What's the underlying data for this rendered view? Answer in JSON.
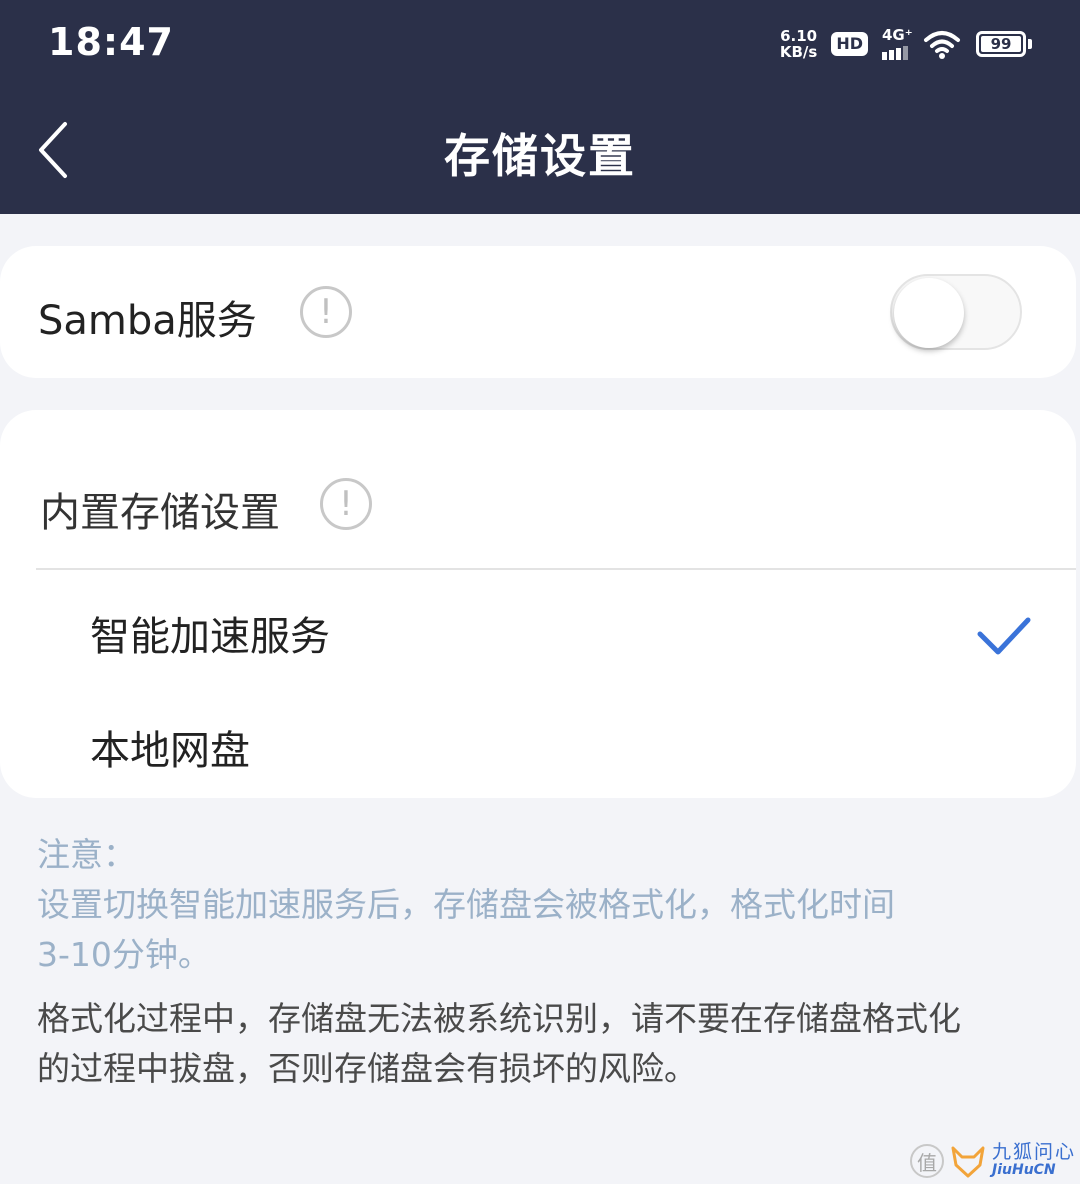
{
  "status_bar": {
    "time": "18:47",
    "net_speed_value": "6.10",
    "net_speed_unit": "KB/s",
    "hd_label": "HD",
    "network_label": "4G⁺",
    "battery_level": "99"
  },
  "header": {
    "title": "存储设置"
  },
  "samba": {
    "label": "Samba服务",
    "info_glyph": "!",
    "enabled": false
  },
  "storage": {
    "section_title": "内置存储设置",
    "info_glyph": "!",
    "options": [
      {
        "label": "智能加速服务",
        "selected": true
      },
      {
        "label": "本地网盘",
        "selected": false
      }
    ]
  },
  "notes": {
    "heading": "注意：",
    "line1": "设置切换智能加速服务后，存储盘会被格式化，格式化时间",
    "line2": "3-10分钟。",
    "line3": "格式化过程中，存储盘无法被系统识别，请不要在存储盘格式化",
    "line4": "的过程中拔盘，否则存储盘会有损坏的风险。"
  },
  "watermark": {
    "zhi": "值",
    "cn": "九狐问心",
    "en": "JiuHuCN"
  },
  "colors": {
    "header_bg": "#2b3049",
    "accent_check": "#3a73d9",
    "note_blue": "#9bb1c8"
  }
}
